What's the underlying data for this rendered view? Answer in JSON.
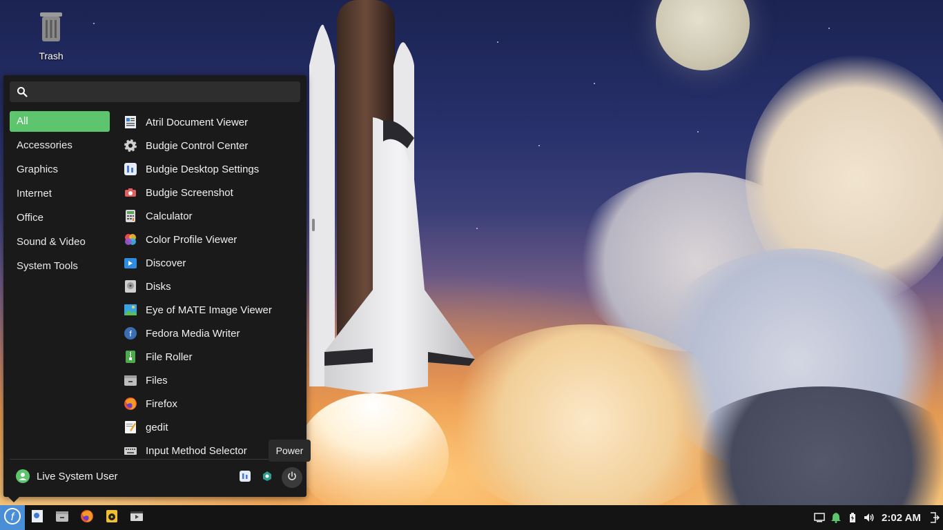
{
  "desktop": {
    "trash_label": "Trash"
  },
  "menu": {
    "search_placeholder": "",
    "categories": [
      {
        "label": "All",
        "active": true
      },
      {
        "label": "Accessories"
      },
      {
        "label": "Graphics"
      },
      {
        "label": "Internet"
      },
      {
        "label": "Office"
      },
      {
        "label": "Sound & Video"
      },
      {
        "label": "System Tools"
      }
    ],
    "apps": [
      {
        "label": "Atril Document Viewer",
        "icon": "document-viewer-icon"
      },
      {
        "label": "Budgie Control Center",
        "icon": "gear-icon"
      },
      {
        "label": "Budgie Desktop Settings",
        "icon": "desktop-settings-icon"
      },
      {
        "label": "Budgie Screenshot",
        "icon": "camera-icon"
      },
      {
        "label": "Calculator",
        "icon": "calculator-icon"
      },
      {
        "label": "Color Profile Viewer",
        "icon": "color-profile-icon"
      },
      {
        "label": "Discover",
        "icon": "discover-icon"
      },
      {
        "label": "Disks",
        "icon": "disks-icon"
      },
      {
        "label": "Eye of MATE Image Viewer",
        "icon": "image-viewer-icon"
      },
      {
        "label": "Fedora Media Writer",
        "icon": "media-writer-icon"
      },
      {
        "label": "File Roller",
        "icon": "archive-icon"
      },
      {
        "label": "Files",
        "icon": "files-icon"
      },
      {
        "label": "Firefox",
        "icon": "firefox-icon"
      },
      {
        "label": "gedit",
        "icon": "text-editor-icon"
      },
      {
        "label": "Input Method Selector",
        "icon": "keyboard-icon"
      }
    ],
    "user_name": "Live System User",
    "power_tooltip": "Power"
  },
  "panel": {
    "clock": "2:02 AM",
    "accent": "#5ec56f"
  }
}
